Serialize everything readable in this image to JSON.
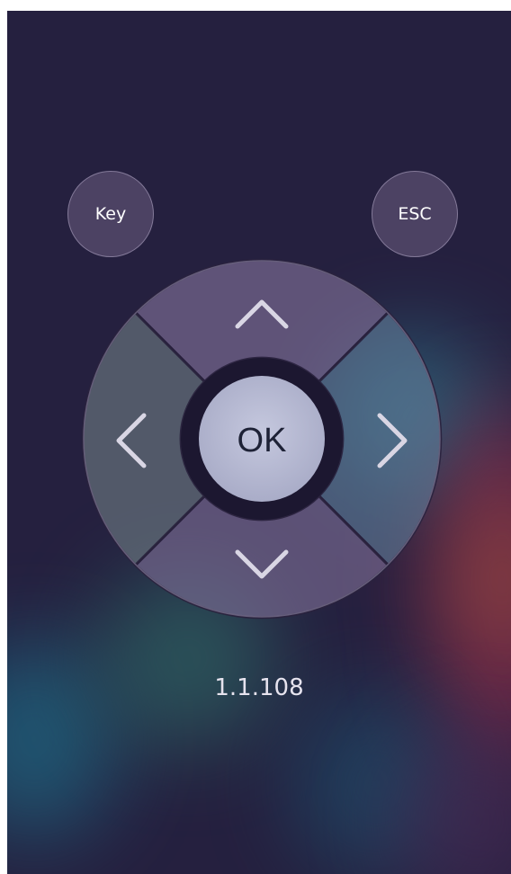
{
  "buttons": {
    "key_label": "Key",
    "esc_label": "ESC",
    "ok_label": "OK"
  },
  "dpad": {
    "up_icon": "chevron-up-icon",
    "down_icon": "chevron-down-icon",
    "left_icon": "chevron-left-icon",
    "right_icon": "chevron-right-icon"
  },
  "version": "1.1.108",
  "colors": {
    "background": "#25203f",
    "button_fill": "#6e5f82",
    "ok_fill": "#b7bad2",
    "ok_text": "#1e2236",
    "text": "#ffffff"
  }
}
